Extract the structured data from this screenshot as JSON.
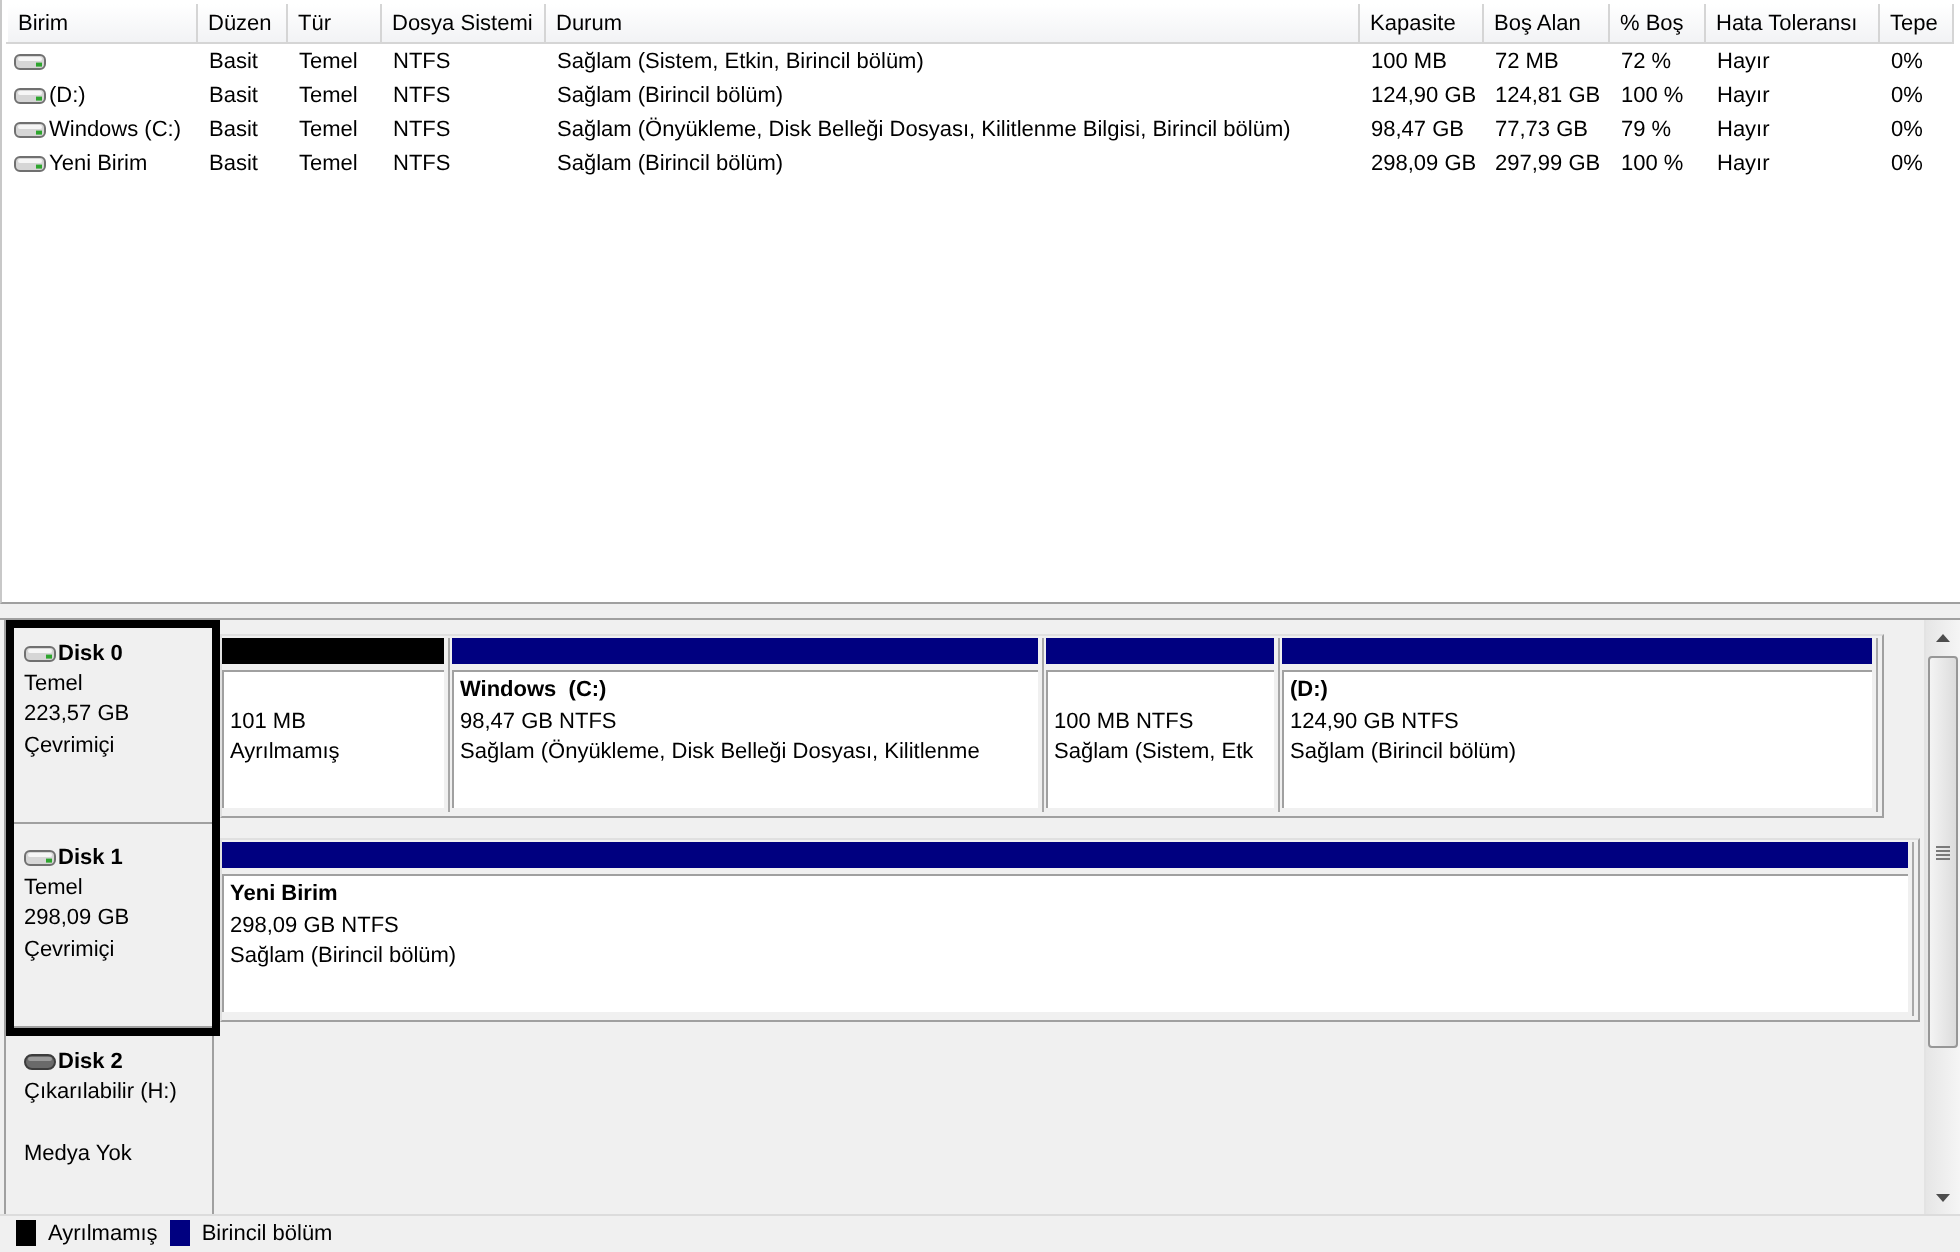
{
  "volume_list": {
    "columns": [
      "Birim",
      "Düzen",
      "Tür",
      "Dosya Sistemi",
      "Durum",
      "Kapasite",
      "Boş Alan",
      "% Boş",
      "Hata Toleransı",
      "Tepe"
    ],
    "rows": [
      {
        "layout": "Basit",
        "type": "Temel",
        "file_system": "NTFS",
        "status": "Sağlam (Sistem, Etkin, Birincil bölüm)",
        "capacity": "100 MB",
        "free_space": "72 MB",
        "percent_free": "72 %",
        "fault_tolerance": "Hayır",
        "overhead": "0%"
      },
      {
        "volume": "(D:)",
        "layout": "Basit",
        "type": "Temel",
        "file_system": "NTFS",
        "status": "Sağlam (Birincil bölüm)",
        "capacity": "124,90 GB",
        "free_space": "124,81 GB",
        "percent_free": "100 %",
        "fault_tolerance": "Hayır",
        "overhead": "0%"
      },
      {
        "volume": "Windows (C:)",
        "layout": "Basit",
        "type": "Temel",
        "file_system": "NTFS",
        "status": "Sağlam (Önyükleme, Disk Belleği Dosyası, Kilitlenme Bilgisi, Birincil bölüm)",
        "capacity": "98,47 GB",
        "free_space": "77,73 GB",
        "percent_free": "79 %",
        "fault_tolerance": "Hayır",
        "overhead": "0%"
      },
      {
        "volume": "Yeni Birim",
        "layout": "Basit",
        "type": "Temel",
        "file_system": "NTFS",
        "status": "Sağlam (Birincil bölüm)",
        "capacity": "298,09 GB",
        "free_space": "297,99 GB",
        "percent_free": "100 %",
        "fault_tolerance": "Hayır",
        "overhead": "0%"
      }
    ]
  },
  "disks": [
    {
      "name": "Disk 0",
      "kind": "fixed",
      "type": "Temel",
      "size": "223,57 GB",
      "status": "Çevrimiçi",
      "highlighted": true,
      "partitions": [
        {
          "kind": "unallocated",
          "size": "101 MB",
          "status": "Ayrılmamış"
        },
        {
          "kind": "primary",
          "label": "Windows  (C:)",
          "size": "98,47 GB NTFS",
          "status": "Sağlam (Önyükleme, Disk Belleği Dosyası, Kilitlenme"
        },
        {
          "kind": "primary",
          "size": "100 MB NTFS",
          "status": "Sağlam (Sistem, Etk"
        },
        {
          "kind": "primary",
          "label": "(D:)",
          "size": "124,90 GB NTFS",
          "status": "Sağlam (Birincil bölüm)"
        }
      ]
    },
    {
      "name": "Disk 1",
      "kind": "fixed",
      "type": "Temel",
      "size": "298,09 GB",
      "status": "Çevrimiçi",
      "highlighted": true,
      "partitions": [
        {
          "kind": "primary",
          "label": "Yeni Birim",
          "size": "298,09 GB NTFS",
          "status": "Sağlam (Birincil bölüm)"
        }
      ]
    },
    {
      "name": "Disk 2",
      "kind": "removable",
      "type": "Çıkarılabilir (H:)",
      "status": "Medya Yok",
      "highlighted": false
    }
  ],
  "legend": [
    {
      "label": "Ayrılmamış",
      "color": "#000000"
    },
    {
      "label": "Birincil bölüm",
      "color": "#000080"
    }
  ]
}
